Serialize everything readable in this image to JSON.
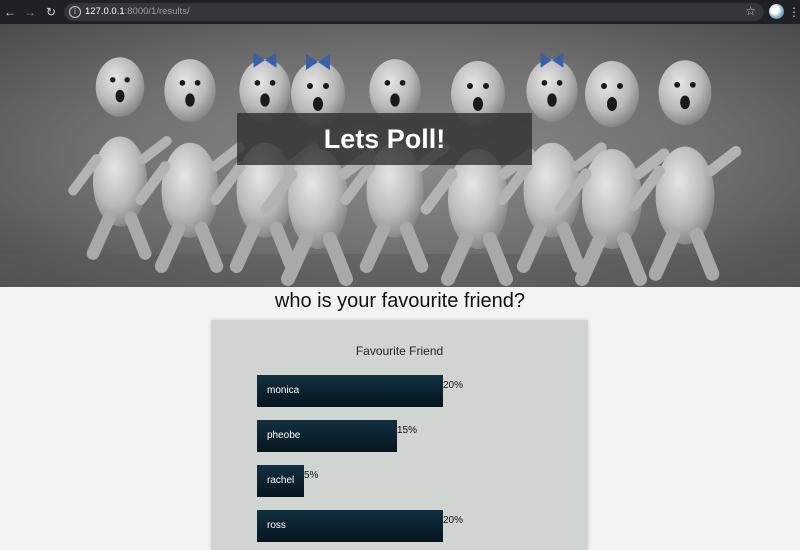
{
  "browser": {
    "url_host": "127.0.0.1",
    "url_path": ":8000/1/results/",
    "icons": [
      "back-arrow-icon",
      "forward-arrow-icon",
      "reload-icon",
      "info-icon",
      "star-icon",
      "profile-avatar",
      "menu-dots-icon"
    ]
  },
  "hero": {
    "title": "Lets Poll!"
  },
  "poll": {
    "question": "who is your favourite friend?",
    "chart_title": "Favourite Friend",
    "bar_color": "#0b2230"
  },
  "chart_data": {
    "type": "bar",
    "orientation": "horizontal",
    "title": "Favourite Friend",
    "categories": [
      "monica",
      "pheobe",
      "rachel",
      "ross"
    ],
    "values": [
      20,
      15,
      5,
      20
    ],
    "value_labels": [
      "20%",
      "15%",
      "5%",
      "20%"
    ],
    "unit": "%"
  }
}
